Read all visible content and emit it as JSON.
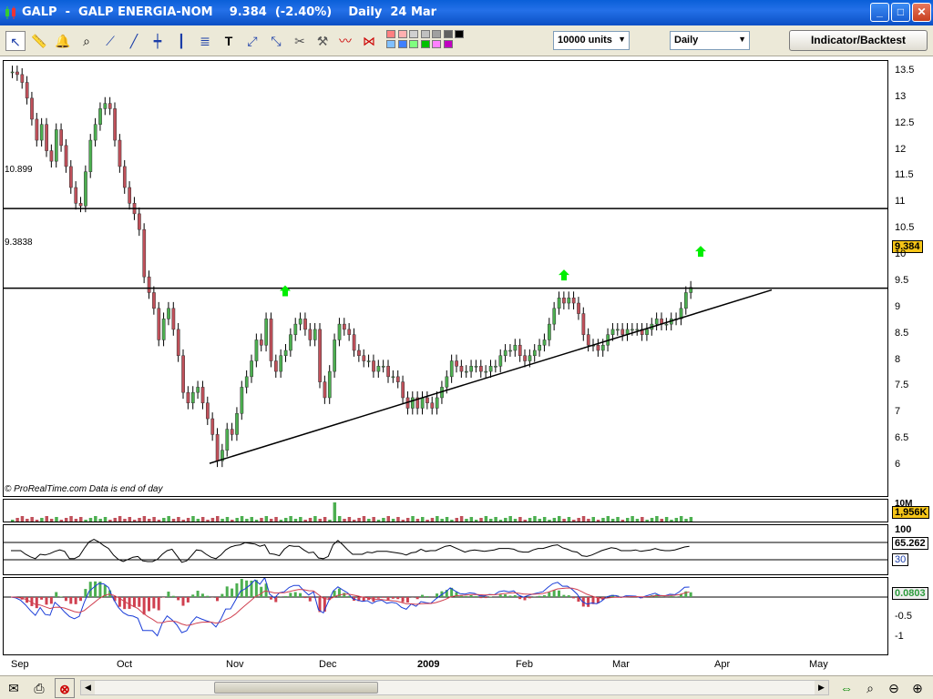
{
  "window": {
    "title": "GALP  -  GALP ENERGIA-NOM    9.384  (-2.40%)    Daily  24 Mar",
    "min": "_",
    "max": "□",
    "close": "✕"
  },
  "toolbar": {
    "units": "10000 units",
    "timeframe": "Daily",
    "indicator_button": "Indicator/Backtest",
    "palette": [
      "#ff8080",
      "#ffb0b0",
      "#d0d0d0",
      "#c0c0c0",
      "#a0a0a0",
      "#606060",
      "#000000",
      "#80c0ff",
      "#4080ff",
      "#80ff80",
      "#00c000",
      "#ff80ff",
      "#c000c0"
    ]
  },
  "chart": {
    "price_ticks": [
      "13.5",
      "13",
      "12.5",
      "12",
      "11.5",
      "11",
      "10.5",
      "10",
      "9.5",
      "9",
      "8.5",
      "8",
      "7.5",
      "7",
      "6.5",
      "6"
    ],
    "hlines": [
      {
        "label": "10.899"
      },
      {
        "label": "9.3838"
      }
    ],
    "last_price": "9.384",
    "credit": "© ProRealTime.com  Data is end of day",
    "volume_max_label": "10M",
    "volume_value": "1,956K",
    "rsi_top_label": "100",
    "rsi_value": "65.262",
    "rsi_low_label": "30",
    "macd_value": "0.0803",
    "macd_ticks": [
      "-0.5",
      "-1"
    ],
    "macd_zero": "0",
    "months": [
      "Sep",
      "Oct",
      "Nov",
      "Dec",
      "2009",
      "Feb",
      "Mar",
      "Apr",
      "May"
    ],
    "colors": {
      "up": "#4caf50",
      "down": "#c0505a",
      "arrow": "#00ee00",
      "rsi": "#000000",
      "macd_hist_pos": "#4caf50",
      "macd_hist_neg": "#d04050"
    }
  },
  "footer": {
    "icons": [
      "mail-icon",
      "print-icon",
      "no-toggle-icon"
    ],
    "zoom_icons": [
      "zoom-fit-icon",
      "zoom-search-icon",
      "zoom-out-icon",
      "zoom-in-icon"
    ]
  }
}
